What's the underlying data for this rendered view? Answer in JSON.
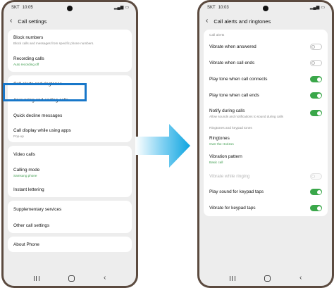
{
  "left_phone": {
    "status": {
      "carrier": "SKT",
      "time": "10:05",
      "battery": "▎"
    },
    "title": "Call settings",
    "groups": [
      {
        "items": [
          {
            "label": "Block numbers",
            "sub": "Block calls and messages from specific phone numbers."
          },
          {
            "label": "Recording calls",
            "sub": "Auto recording off",
            "sub_color": "green"
          }
        ]
      },
      {
        "items": [
          {
            "label": "Call alerts and ringtones"
          },
          {
            "label": "Answering and ending calls"
          },
          {
            "label": "Quick decline messages"
          },
          {
            "label": "Call display while using apps",
            "sub": "Pop-up"
          }
        ]
      },
      {
        "items": [
          {
            "label": "Video calls"
          },
          {
            "label": "Calling mode",
            "sub": "Samsung phone",
            "sub_color": "green"
          },
          {
            "label": "Instant lettering"
          }
        ]
      },
      {
        "items": [
          {
            "label": "Supplementary services"
          },
          {
            "label": "Other call settings"
          }
        ]
      },
      {
        "items": [
          {
            "label": "About Phone"
          }
        ]
      }
    ]
  },
  "right_phone": {
    "status": {
      "carrier": "SKT",
      "time": "10:03"
    },
    "title": "Call alerts and ringtones",
    "section_call_alerts": "Call alerts",
    "alerts": [
      {
        "label": "Vibrate when answered",
        "state": "off"
      },
      {
        "label": "Vibrate when call ends",
        "state": "off"
      },
      {
        "label": "Play tone when call connects",
        "state": "on"
      },
      {
        "label": "Play tone when call ends",
        "state": "on"
      },
      {
        "label": "Notify during calls",
        "sub": "Allow sounds and notifications to sound during calls",
        "state": "on"
      }
    ],
    "section_ringtones": "Ringtones and keypad tones",
    "ringtones": [
      {
        "label": "Ringtones",
        "sub": "Over the Horizon",
        "sub_color": "green"
      },
      {
        "label": "Vibration pattern",
        "sub": "Basic call",
        "sub_color": "green"
      },
      {
        "label": "Vibrate while ringing",
        "state": "disabled",
        "dim": true
      },
      {
        "label": "Play sound for keypad taps",
        "state": "on"
      },
      {
        "label": "Vibrate for keypad taps",
        "state": "on"
      }
    ]
  },
  "colors": {
    "highlight": "#1877c9",
    "toggle_on": "#3aa74a",
    "arrow": "#0ea5e0"
  },
  "icons": {
    "back": "chevron-left-icon",
    "arrow": "arrow-right-icon"
  }
}
